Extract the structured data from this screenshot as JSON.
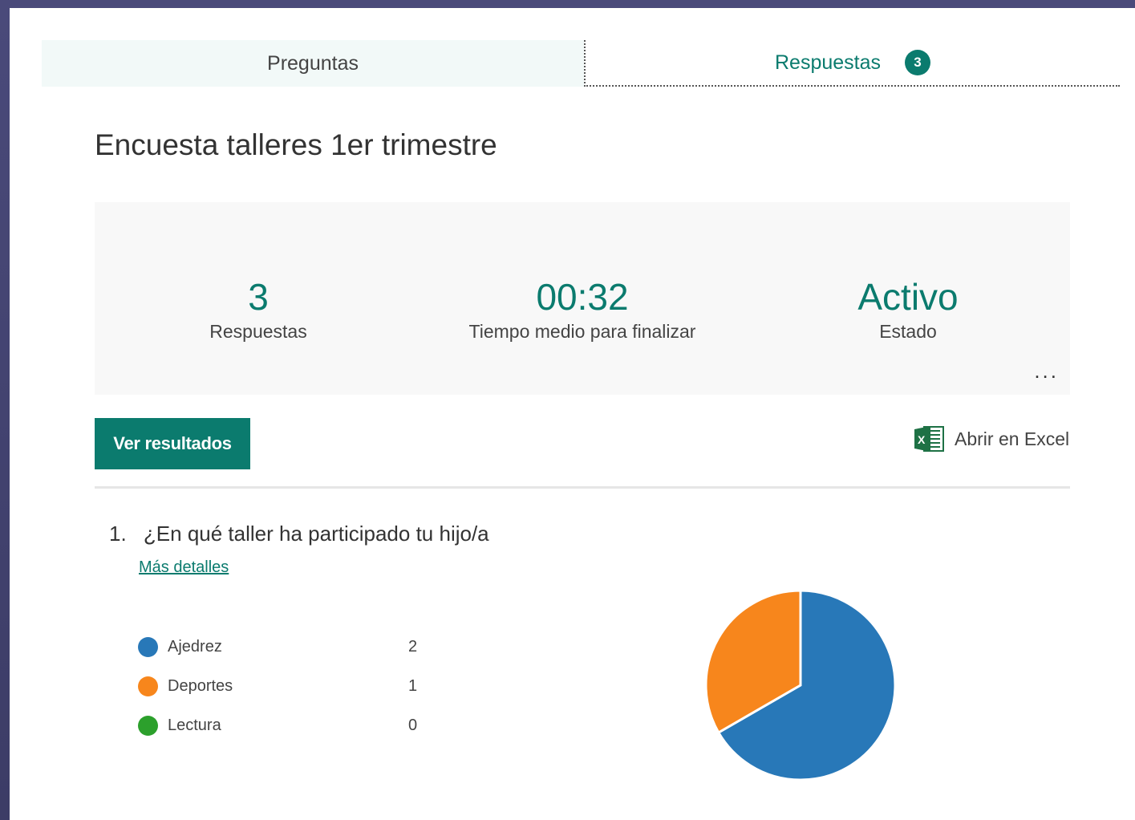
{
  "tabs": {
    "questions_label": "Preguntas",
    "responses_label": "Respuestas",
    "responses_badge": "3"
  },
  "form": {
    "title": "Encuesta talleres 1er trimestre"
  },
  "summary": {
    "responses_value": "3",
    "responses_label": "Respuestas",
    "avg_time_value": "00:32",
    "avg_time_label": "Tiempo medio para finalizar",
    "status_value": "Activo",
    "status_label": "Estado",
    "more_label": "..."
  },
  "actions": {
    "view_results_label": "Ver resultados",
    "open_excel_label": "Abrir en Excel"
  },
  "question": {
    "number": "1.",
    "text": "¿En qué taller ha participado tu hijo/a",
    "more_details_label": "Más detalles",
    "options": [
      {
        "label": "Ajedrez",
        "count": "2",
        "color": "#2878b8"
      },
      {
        "label": "Deportes",
        "count": "1",
        "color": "#f7861c"
      },
      {
        "label": "Lectura",
        "count": "0",
        "color": "#2ca02c"
      }
    ]
  },
  "chart_data": {
    "type": "pie",
    "categories": [
      "Ajedrez",
      "Deportes",
      "Lectura"
    ],
    "values": [
      2,
      1,
      0
    ],
    "colors": [
      "#2878b8",
      "#f7861c",
      "#2ca02c"
    ]
  },
  "colors": {
    "accent": "#0b7b6e"
  }
}
